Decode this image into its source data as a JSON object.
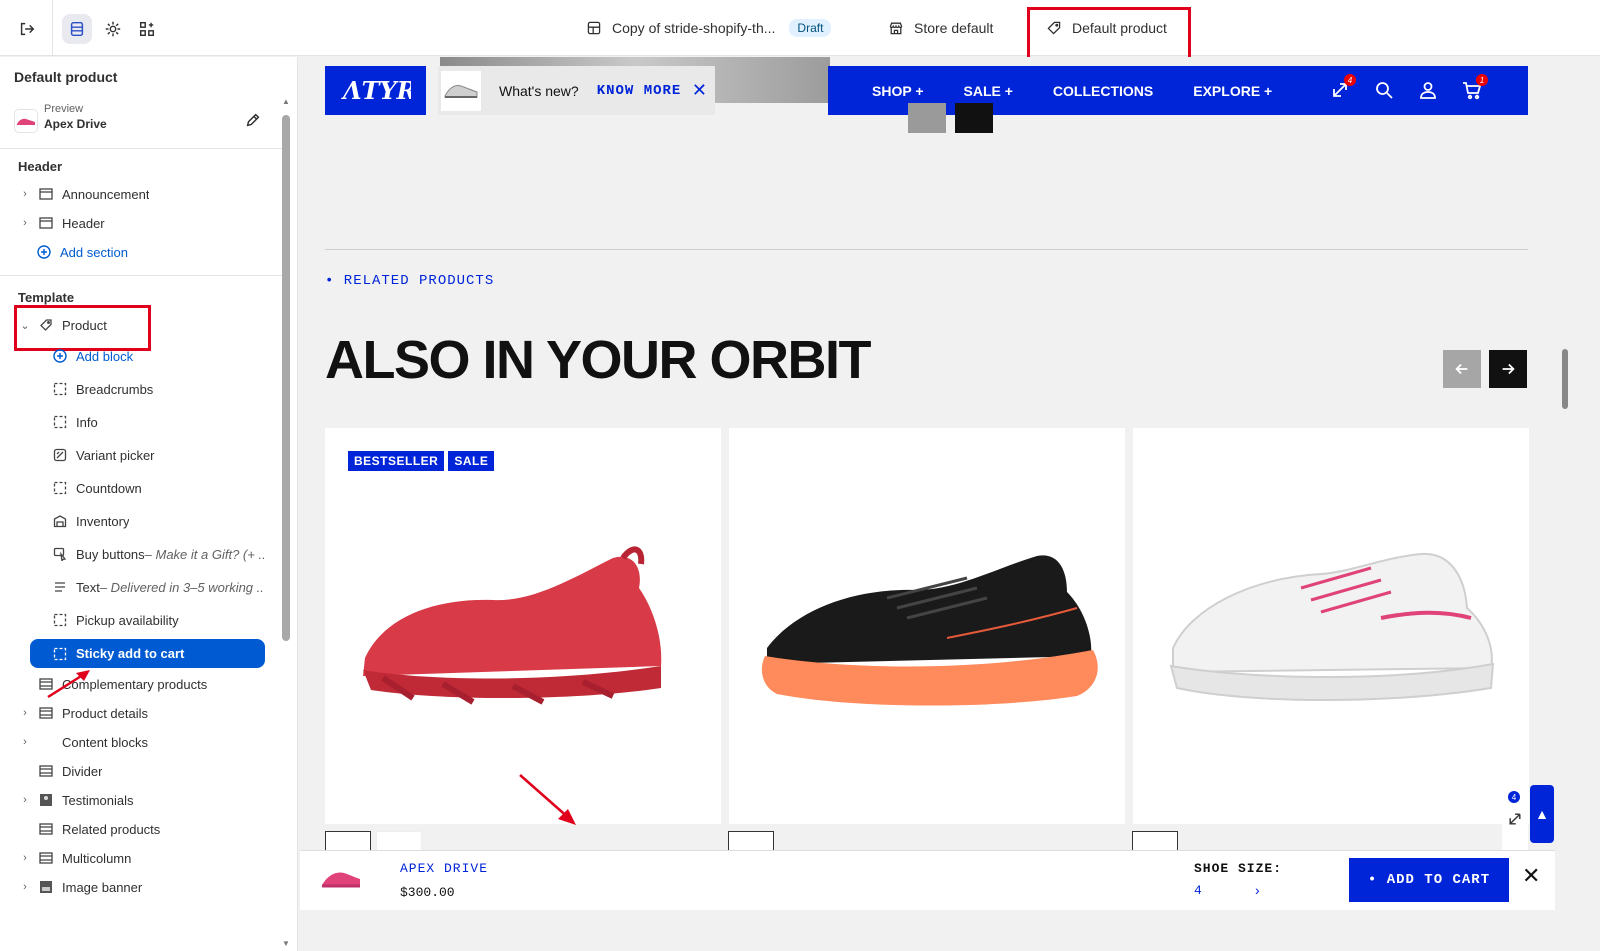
{
  "topbar": {
    "theme_name": "Copy of stride-shopify-th...",
    "draft_label": "Draft",
    "store_label": "Store default",
    "template_label": "Default product"
  },
  "sidebar": {
    "title": "Default product",
    "preview_label": "Preview",
    "preview_value": "Apex Drive",
    "header_group": "Header",
    "header_items": [
      {
        "label": "Announcement"
      },
      {
        "label": "Header"
      }
    ],
    "add_section": "Add section",
    "template_group": "Template",
    "product_label": "Product",
    "add_block": "Add block",
    "blocks": [
      {
        "label": "Breadcrumbs"
      },
      {
        "label": "Info"
      },
      {
        "label": "Variant picker"
      },
      {
        "label": "Countdown"
      },
      {
        "label": "Inventory"
      },
      {
        "label": "Buy buttons",
        "sub": " – Make it a Gift? (+ ..."
      },
      {
        "label": "Text",
        "sub": " – Delivered in 3–5 working ..."
      },
      {
        "label": "Pickup availability"
      },
      {
        "label": "Sticky add to cart"
      }
    ],
    "sections": [
      {
        "label": "Complementary products"
      },
      {
        "label": "Product details"
      },
      {
        "label": "Content blocks"
      },
      {
        "label": "Divider"
      },
      {
        "label": "Testimonials"
      },
      {
        "label": "Related products"
      },
      {
        "label": "Multicolumn"
      },
      {
        "label": "Image banner"
      }
    ]
  },
  "storefront": {
    "announcement_question": "What's new?",
    "announcement_link": "KNOW MORE",
    "nav": [
      "SHOP +",
      "SALE +",
      "COLLECTIONS",
      "EXPLORE +"
    ],
    "compare_count": "4",
    "cart_count": "1",
    "eyebrow": "• RELATED PRODUCTS",
    "heading": "ALSO IN YOUR ORBIT",
    "badges": [
      "BESTSELLER",
      "SALE"
    ],
    "side_widget_count": "4"
  },
  "sticky": {
    "product_name": "APEX DRIVE",
    "price": "$300.00",
    "size_label": "SHOE SIZE:",
    "size_value": "4",
    "add_to_cart": "• ADD TO CART"
  },
  "colors": {
    "brand_blue": "#0024d8",
    "admin_blue": "#005bd3",
    "annotation_red": "#e0001b"
  }
}
